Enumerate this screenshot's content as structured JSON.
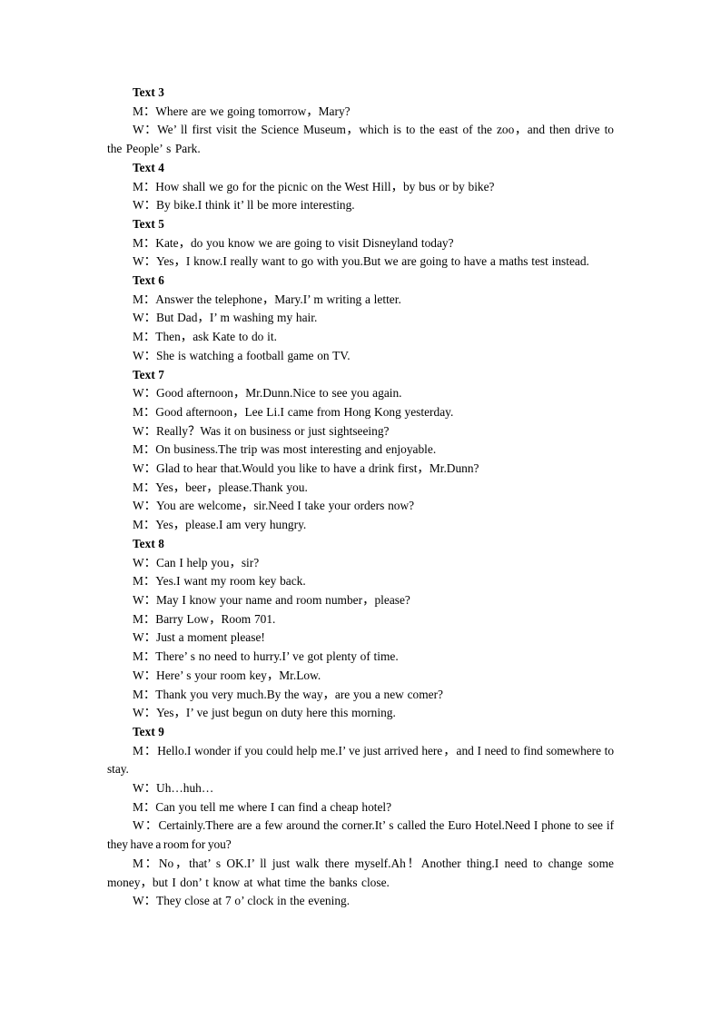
{
  "document": {
    "sections": [
      {
        "heading": "Text 3",
        "lines": [
          "M：Where are we going tomorrow，Mary?",
          "W：We’ ll first visit the Science Museum，which is to the east of the zoo，and then drive to the People’ s Park."
        ]
      },
      {
        "heading": "Text 4",
        "lines": [
          "M：How shall we go for the picnic on the West Hill，by bus or by bike?",
          "W：By bike.I think it’ ll be more interesting."
        ]
      },
      {
        "heading": "Text 5",
        "lines": [
          "M：Kate，do you know we are going to visit Disneyland today?",
          "W：Yes，I know.I really want to go with you.But we are going to have a maths test instead."
        ]
      },
      {
        "heading": "Text 6",
        "lines": [
          "M：Answer the telephone，Mary.I’ m writing a letter.",
          "W：But Dad，I’ m washing my hair.",
          "M：Then，ask Kate to do it.",
          "W：She is watching a football game on TV."
        ]
      },
      {
        "heading": "Text 7",
        "lines": [
          "W：Good afternoon，Mr.Dunn.Nice to see you again.",
          "M：Good afternoon，Lee Li.I came from Hong Kong yesterday.",
          "W：Really？Was it on business or just sightseeing?",
          "M：On business.The trip was most interesting and enjoyable.",
          "W：Glad to hear that.Would you like to have a drink first，Mr.Dunn?",
          "M：Yes，beer，please.Thank you.",
          "W：You are welcome，sir.Need I take your orders now?",
          "M：Yes，please.I am very hungry."
        ]
      },
      {
        "heading": "Text 8",
        "lines": [
          "W：Can I help you，sir?",
          "M：Yes.I want my room key back.",
          "W：May I know your name and room number，please?",
          "M：Barry Low，Room 701.",
          "W：Just a moment please!",
          "M：There’ s no need to hurry.I’ ve got plenty of time.",
          "W：Here’ s your room key，Mr.Low.",
          "M：Thank you very much.By the way，are you a new comer?",
          "W：Yes，I’ ve just begun on duty here this morning."
        ]
      },
      {
        "heading": "Text 9",
        "lines": [
          "M：Hello.I wonder if you could help me.I’ ve just arrived here，and I need to find somewhere to stay.",
          "W：Uh…huh…",
          "M：Can you tell me where I can find a cheap hotel?",
          "W：Certainly.There are a few around the corner.It’ s called the Euro Hotel.Need I phone to see if they have a room for you?",
          "M：No，that’ s OK.I’ ll just walk there myself.Ah！Another thing.I need to change some money，but I don’ t know at what time the banks close.",
          "W：They close at 7 o’ clock in the evening."
        ]
      }
    ]
  }
}
